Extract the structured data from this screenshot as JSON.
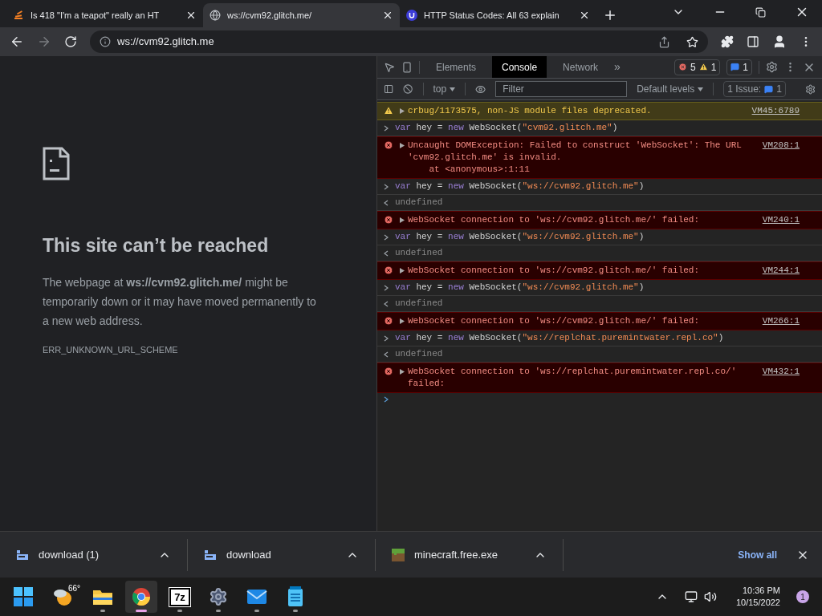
{
  "browser_tabs": [
    {
      "title": "Is 418 \"I'm a teapot\" really an HT",
      "selected": false
    },
    {
      "title": "ws://cvm92.glitch.me/",
      "selected": true
    },
    {
      "title": "HTTP Status Codes: All 63 explain",
      "selected": false
    }
  ],
  "address_bar": {
    "url": "ws://cvm92.glitch.me"
  },
  "error_page": {
    "title": "This site can’t be reached",
    "message": "The webpage at **ws://cvm92.glitch.me/** might be temporarily down or it may have moved permanently to a new web address.",
    "code": "ERR_UNKNOWN_URL_SCHEME"
  },
  "devtools": {
    "tabs": [
      {
        "label": "Elements",
        "selected": false
      },
      {
        "label": "Console",
        "selected": true
      },
      {
        "label": "Network",
        "selected": false
      }
    ],
    "more": "»",
    "error_count": "5",
    "warning_count": "1",
    "message_count": "1",
    "context": "top",
    "filter_placeholder": "Filter",
    "levels": "Default levels",
    "issues_label": "1 Issue:",
    "issues_count": "1",
    "entries": [
      {
        "kind": "warning",
        "lines": [
          "crbug/1173575, non-JS module files deprecated."
        ],
        "source": "VM45:6789"
      },
      {
        "kind": "input",
        "code": [
          {
            "t": "var",
            "kind": "keyword"
          },
          {
            "t": " hey = ",
            "kind": "plain"
          },
          {
            "t": "new",
            "kind": "keyword"
          },
          {
            "t": " WebSocket(",
            "kind": "plain"
          },
          {
            "t": "\"cvm92.glitch.me\"",
            "kind": "string"
          },
          {
            "t": ")",
            "kind": "plain"
          }
        ]
      },
      {
        "kind": "error",
        "lines": [
          "Uncaught DOMException: Failed to construct 'WebSocket': The URL 'cvm92.glitch.me' is invalid.",
          "    at <anonymous>:1:11"
        ],
        "source": "VM208:1"
      },
      {
        "kind": "input",
        "code": [
          {
            "t": "var",
            "kind": "keyword"
          },
          {
            "t": " hey = ",
            "kind": "plain"
          },
          {
            "t": "new",
            "kind": "keyword"
          },
          {
            "t": " WebSocket(",
            "kind": "plain"
          },
          {
            "t": "\"ws://cvm92.glitch.me\"",
            "kind": "string"
          },
          {
            "t": ")",
            "kind": "plain"
          }
        ]
      },
      {
        "kind": "output",
        "text": "undefined"
      },
      {
        "kind": "error",
        "lines": [
          "WebSocket connection to 'ws://cvm92.glitch.me/' failed:"
        ],
        "source": "VM240:1"
      },
      {
        "kind": "input",
        "code": [
          {
            "t": "var",
            "kind": "keyword"
          },
          {
            "t": " hey = ",
            "kind": "plain"
          },
          {
            "t": "new",
            "kind": "keyword"
          },
          {
            "t": " WebSocket(",
            "kind": "plain"
          },
          {
            "t": "\"ws://cvm92.glitch.me\"",
            "kind": "string"
          },
          {
            "t": ")",
            "kind": "plain"
          }
        ]
      },
      {
        "kind": "output",
        "text": "undefined"
      },
      {
        "kind": "error",
        "lines": [
          "WebSocket connection to 'ws://cvm92.glitch.me/' failed:"
        ],
        "source": "VM244:1"
      },
      {
        "kind": "input",
        "code": [
          {
            "t": "var",
            "kind": "keyword"
          },
          {
            "t": " hey = ",
            "kind": "plain"
          },
          {
            "t": "new",
            "kind": "keyword"
          },
          {
            "t": " WebSocket(",
            "kind": "plain"
          },
          {
            "t": "\"ws://cvm92.glitch.me\"",
            "kind": "string"
          },
          {
            "t": ")",
            "kind": "plain"
          }
        ]
      },
      {
        "kind": "output",
        "text": "undefined"
      },
      {
        "kind": "error",
        "lines": [
          "WebSocket connection to 'ws://cvm92.glitch.me/' failed:"
        ],
        "source": "VM266:1"
      },
      {
        "kind": "input",
        "code": [
          {
            "t": "var",
            "kind": "keyword"
          },
          {
            "t": " hey = ",
            "kind": "plain"
          },
          {
            "t": "new",
            "kind": "keyword"
          },
          {
            "t": " WebSocket(",
            "kind": "plain"
          },
          {
            "t": "\"ws://replchat.puremintwater.repl.co\"",
            "kind": "string"
          },
          {
            "t": ")",
            "kind": "plain"
          }
        ]
      },
      {
        "kind": "output",
        "text": "undefined"
      },
      {
        "kind": "error",
        "lines": [
          "WebSocket connection to 'ws://replchat.puremintwater.repl.co/' failed:"
        ],
        "source": "VM432:1"
      }
    ]
  },
  "downloads": {
    "items": [
      {
        "name": "download (1)",
        "kind": "file"
      },
      {
        "name": "download",
        "kind": "file"
      },
      {
        "name": "minecraft.free.exe",
        "kind": "program"
      }
    ],
    "show_all": "Show all"
  },
  "taskbar": {
    "weather": "66°",
    "apps": [
      {
        "kind": "explorer",
        "running": true,
        "active": false
      },
      {
        "kind": "chrome",
        "running": true,
        "active": true
      },
      {
        "kind": "archive",
        "running": true,
        "active": false,
        "label": "7z"
      },
      {
        "kind": "settings",
        "running": true,
        "active": false
      },
      {
        "kind": "mail",
        "running": true,
        "active": false
      },
      {
        "kind": "notepad",
        "running": true,
        "active": false
      }
    ],
    "time": "10:36 PM",
    "date": "10/15/2022",
    "notifications": "1"
  }
}
